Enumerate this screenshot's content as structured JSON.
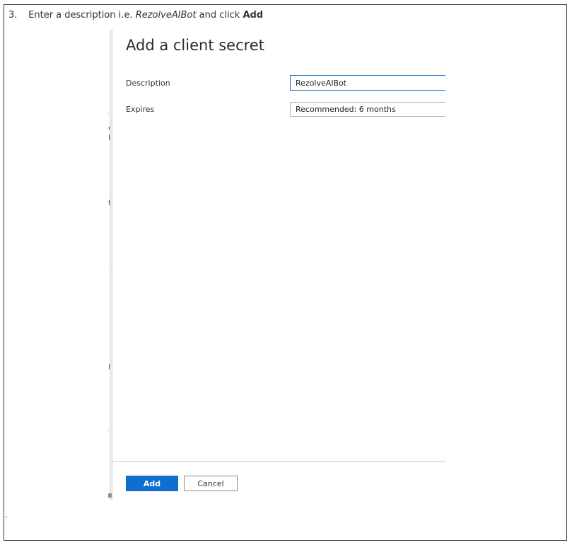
{
  "instruction": {
    "number": "3.",
    "prefix": "Enter a description i.e.",
    "example": "RezolveAIBot",
    "middle": "and click",
    "action": "Add"
  },
  "stray_mark": ".",
  "background_fragments": [
    "er",
    "l.",
    "t",
    "p"
  ],
  "panel": {
    "title": "Add a client secret",
    "description_label": "Description",
    "description_value": "RezolveAIBot",
    "expires_label": "Expires",
    "expires_value": "Recommended: 6 months",
    "add_label": "Add",
    "cancel_label": "Cancel"
  },
  "colors": {
    "primary": "#0f6fcf",
    "focus_border": "#1a73c9"
  }
}
